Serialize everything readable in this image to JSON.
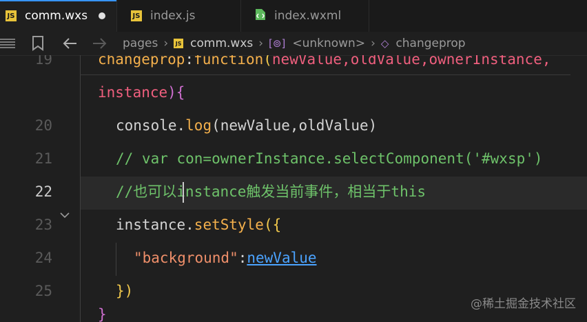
{
  "tabs": [
    {
      "label": "comm.wxs",
      "icon": "js-file-icon",
      "active": true,
      "modified": true
    },
    {
      "label": "index.js",
      "icon": "js-file-icon"
    },
    {
      "label": "index.wxml",
      "icon": "wxml-file-icon"
    }
  ],
  "file_badge": "JS",
  "breadcrumb": {
    "items": [
      "pages",
      "comm.wxs",
      "<unknown>",
      "changeprop"
    ]
  },
  "editor": {
    "lines": [
      {
        "num": "19",
        "cur": false
      },
      {
        "num": "20",
        "cur": false
      },
      {
        "num": "21",
        "cur": false
      },
      {
        "num": "22",
        "cur": true
      },
      {
        "num": "23",
        "cur": false
      },
      {
        "num": "24",
        "cur": false
      },
      {
        "num": "25",
        "cur": false
      }
    ],
    "code": {
      "l1_fn": "changeprop",
      "l1_colon": ":",
      "l1_kw": "function",
      "l1_paren_open": "(",
      "l1_args": "newValue,oldValue,ownerInstance,",
      "l2_arg": "instance",
      "l2_end": "){",
      "l3_a": "console.",
      "l3_b": "log",
      "l3_c": "(newValue,oldValue)",
      "l4": "// var con=ownerInstance.selectComponent('#wxsp')",
      "l5": "//也可以instance触发当前事件，相当于this",
      "l6_a": "instance.",
      "l6_b": "setStyle",
      "l6_c": "({",
      "l7_str": "\"background\"",
      "l7_colon": ":",
      "l7_val": "newValue",
      "l8": "})"
    }
  },
  "watermark": "@稀土掘金技术社区"
}
